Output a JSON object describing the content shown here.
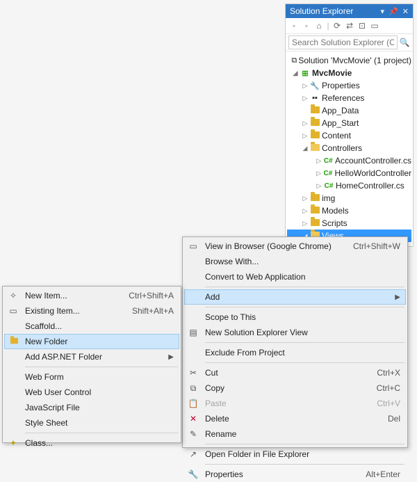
{
  "panel": {
    "title": "Solution Explorer",
    "search_placeholder": "Search Solution Explorer (Ctrl+",
    "solution_label": "Solution 'MvcMovie' (1 project)",
    "project": "MvcMovie",
    "nodes": {
      "properties": "Properties",
      "references": "References",
      "app_data": "App_Data",
      "app_start": "App_Start",
      "content": "Content",
      "controllers": "Controllers",
      "account_ctrl": "AccountController.cs",
      "helloworld_ctrl": "HelloWorldController",
      "home_ctrl": "HomeController.cs",
      "img": "img",
      "models": "Models",
      "scripts": "Scripts",
      "views": "Views"
    }
  },
  "context_menu": {
    "view_browser": "View in Browser (Google Chrome)",
    "view_browser_sc": "Ctrl+Shift+W",
    "browse_with": "Browse With...",
    "convert": "Convert to Web Application",
    "add": "Add",
    "scope": "Scope to This",
    "sol_view": "New Solution Explorer View",
    "exclude": "Exclude From Project",
    "cut": "Cut",
    "cut_sc": "Ctrl+X",
    "copy": "Copy",
    "copy_sc": "Ctrl+C",
    "paste": "Paste",
    "paste_sc": "Ctrl+V",
    "delete": "Delete",
    "delete_sc": "Del",
    "rename": "Rename",
    "open_folder": "Open Folder in File Explorer",
    "properties": "Properties",
    "properties_sc": "Alt+Enter"
  },
  "submenu": {
    "new_item": "New Item...",
    "new_item_sc": "Ctrl+Shift+A",
    "existing_item": "Existing Item...",
    "existing_item_sc": "Shift+Alt+A",
    "scaffold": "Scaffold...",
    "new_folder": "New Folder",
    "add_aspnet": "Add ASP.NET Folder",
    "web_form": "Web Form",
    "web_user_ctrl": "Web User Control",
    "js_file": "JavaScript File",
    "style_sheet": "Style Sheet",
    "class": "Class..."
  }
}
